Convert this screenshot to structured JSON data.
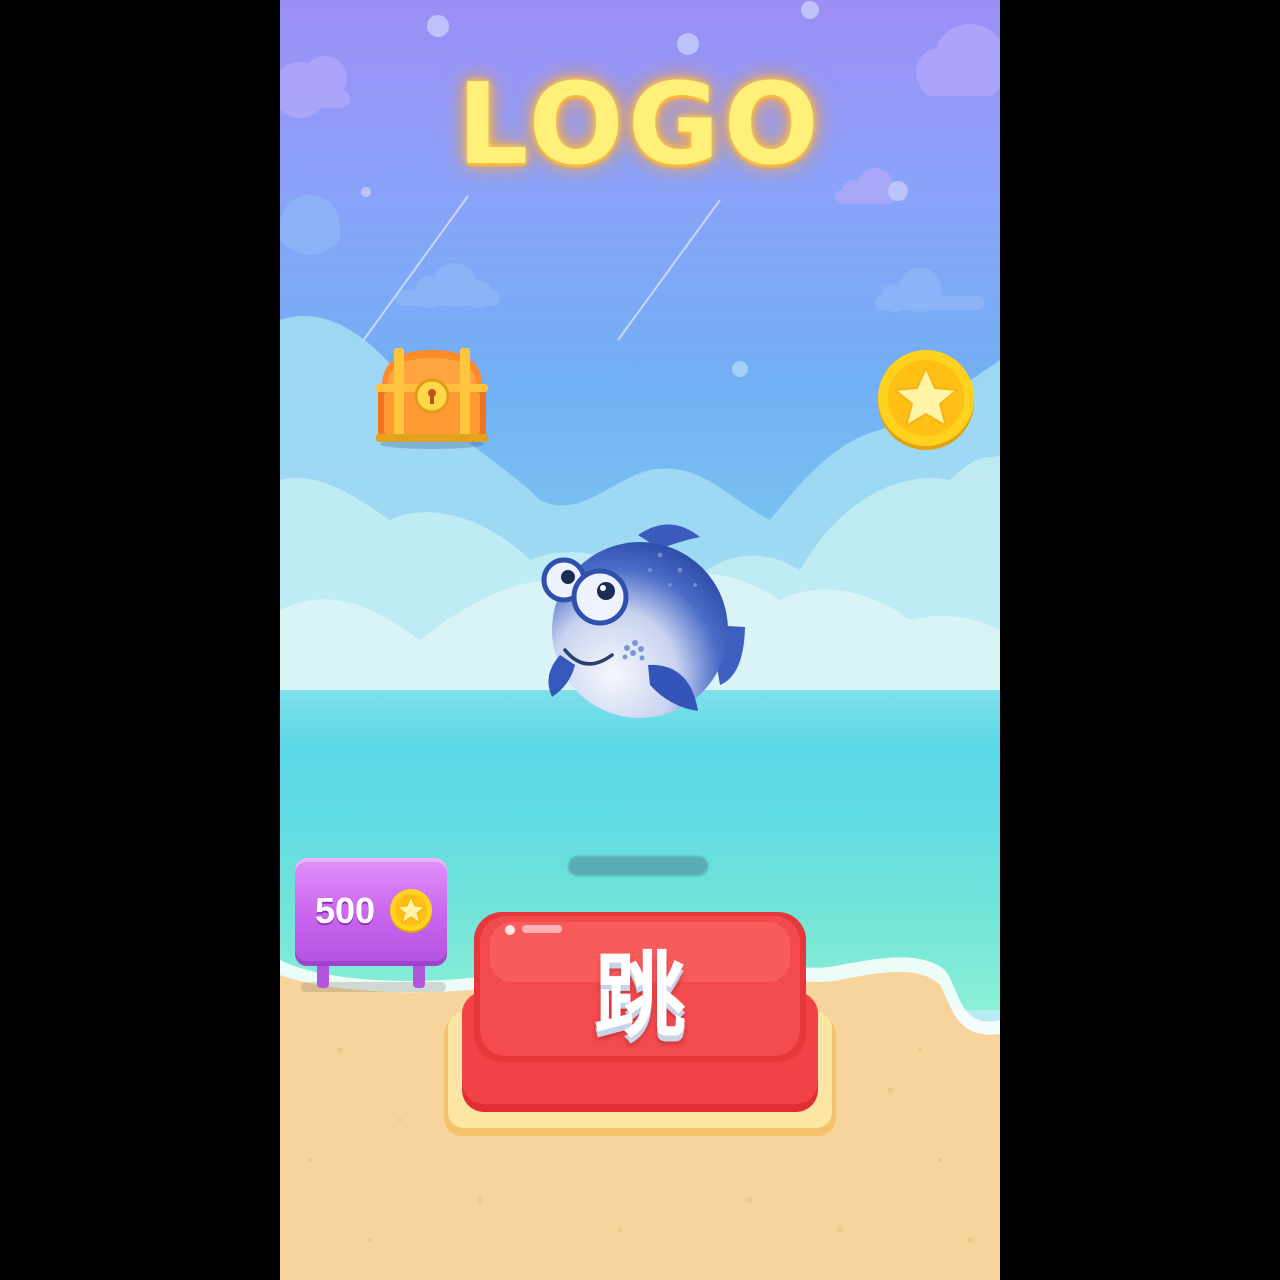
{
  "game": {
    "logo_text": "LOGO",
    "score_value": "500",
    "jump_button_label": "跳"
  },
  "icons": {
    "treasure": "treasure-chest-icon",
    "coin": "star-coin-icon",
    "player": "pufferfish-character"
  },
  "colors": {
    "logo": "#fff07a",
    "jump_button": "#ef3a3e",
    "score_sign": "#c765ee",
    "sand": "#f6d49b",
    "coin": "#ffd21f"
  }
}
